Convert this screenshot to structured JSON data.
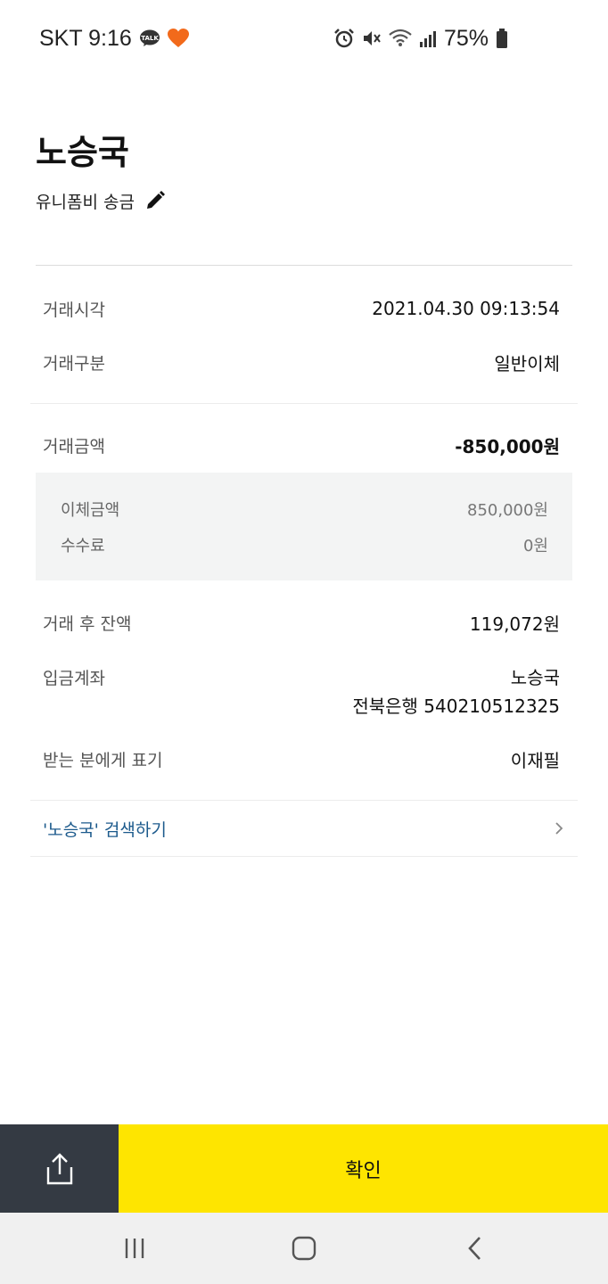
{
  "status_bar": {
    "carrier_time": "SKT 9:16",
    "battery": "75%",
    "icons": [
      "talk-icon",
      "heart-icon",
      "alarm-icon",
      "mute-icon",
      "wifi-icon",
      "signal-icon",
      "battery-icon"
    ]
  },
  "header": {
    "title": "노승국",
    "memo": "유니폼비 송금"
  },
  "details": {
    "time_label": "거래시각",
    "time_value": "2021.04.30 09:13:54",
    "type_label": "거래구분",
    "type_value": "일반이체",
    "amount_label": "거래금액",
    "amount_value": "-850,000원",
    "breakdown": {
      "transfer_label": "이체금액",
      "transfer_value": "850,000원",
      "fee_label": "수수료",
      "fee_value": "0원"
    },
    "balance_label": "거래 후 잔액",
    "balance_value": "119,072원",
    "account_label": "입금계좌",
    "account_name": "노승국",
    "account_number": "전북은행 540210512325",
    "display_label": "받는 분에게 표기",
    "display_value": "이재필"
  },
  "search": {
    "label": "'노승국' 검색하기"
  },
  "actions": {
    "confirm_label": "확인"
  },
  "colors": {
    "accent": "#fee500",
    "share_bg": "#343a43",
    "link": "#1c5a8c",
    "detail_bg": "#f3f4f4"
  }
}
